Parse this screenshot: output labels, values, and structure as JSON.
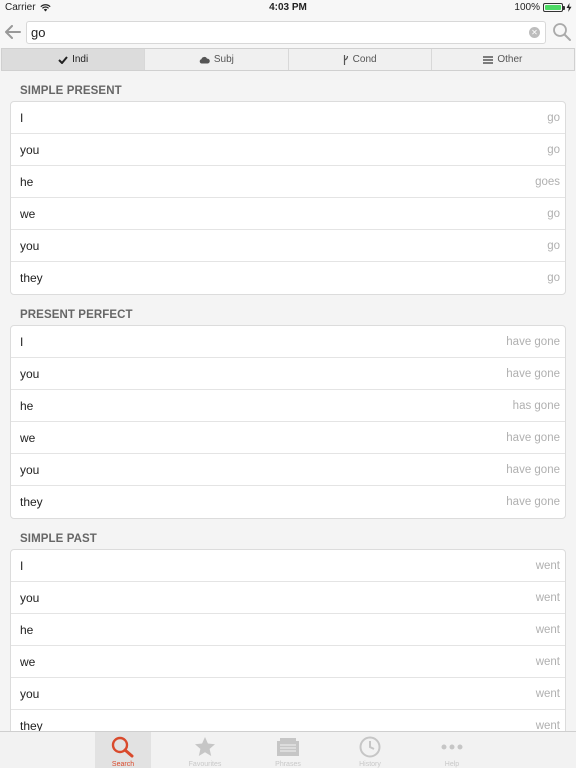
{
  "status": {
    "carrier": "Carrier",
    "time": "4:03 PM",
    "battery": "100%"
  },
  "search": {
    "value": "go",
    "placeholder": ""
  },
  "mood_tabs": [
    {
      "label": "Indi",
      "icon": "checkmark-icon",
      "active": true
    },
    {
      "label": "Subj",
      "icon": "cloud-icon",
      "active": false
    },
    {
      "label": "Cond",
      "icon": "branch-icon",
      "active": false
    },
    {
      "label": "Other",
      "icon": "list-icon",
      "active": false
    }
  ],
  "sections": [
    {
      "title": "SIMPLE PRESENT",
      "rows": [
        {
          "pronoun": "I",
          "form": "go"
        },
        {
          "pronoun": "you",
          "form": "go"
        },
        {
          "pronoun": "he",
          "form": "goes"
        },
        {
          "pronoun": "we",
          "form": "go"
        },
        {
          "pronoun": "you",
          "form": "go"
        },
        {
          "pronoun": "they",
          "form": "go"
        }
      ]
    },
    {
      "title": "PRESENT PERFECT",
      "rows": [
        {
          "pronoun": "I",
          "form": "have gone"
        },
        {
          "pronoun": "you",
          "form": "have gone"
        },
        {
          "pronoun": "he",
          "form": "has gone"
        },
        {
          "pronoun": "we",
          "form": "have gone"
        },
        {
          "pronoun": "you",
          "form": "have gone"
        },
        {
          "pronoun": "they",
          "form": "have gone"
        }
      ]
    },
    {
      "title": "SIMPLE PAST",
      "rows": [
        {
          "pronoun": "I",
          "form": "went"
        },
        {
          "pronoun": "you",
          "form": "went"
        },
        {
          "pronoun": "he",
          "form": "went"
        },
        {
          "pronoun": "we",
          "form": "went"
        },
        {
          "pronoun": "you",
          "form": "went"
        },
        {
          "pronoun": "they",
          "form": "went"
        }
      ]
    }
  ],
  "tab_bar": [
    {
      "label": "Search",
      "icon": "search-icon",
      "active": true
    },
    {
      "label": "Favourites",
      "icon": "star-icon",
      "active": false
    },
    {
      "label": "Phrases",
      "icon": "phrases-icon",
      "active": false
    },
    {
      "label": "History",
      "icon": "clock-icon",
      "active": false
    },
    {
      "label": "Help",
      "icon": "more-icon",
      "active": false
    }
  ],
  "colors": {
    "accent": "#d94a2c",
    "battery": "#4cd964",
    "muted": "#b0b0b0"
  }
}
